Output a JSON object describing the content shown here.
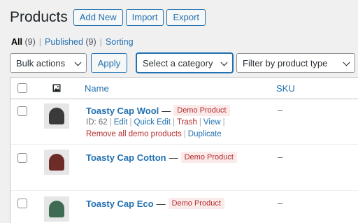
{
  "header": {
    "title": "Products",
    "buttons": {
      "add_new": "Add New",
      "import": "Import",
      "export": "Export"
    }
  },
  "subsubsub": {
    "all": {
      "label": "All",
      "count": "(9)"
    },
    "published": {
      "label": "Published",
      "count": "(9)"
    },
    "sorting": {
      "label": "Sorting"
    },
    "separator": "|"
  },
  "controls": {
    "bulk_actions": "Bulk actions",
    "apply": "Apply",
    "category": "Select a category",
    "product_type": "Filter by product type"
  },
  "table": {
    "columns": {
      "name": "Name",
      "sku": "SKU"
    },
    "rows": [
      {
        "name": "Toasty Cap Wool",
        "dash": "—",
        "badge": "Demo Product",
        "sku": "–",
        "cap_color": "#3a3a3a"
      },
      {
        "name": "Toasty Cap Cotton",
        "dash": "—",
        "badge": "Demo Product",
        "sku": "–",
        "cap_color": "#6e2c28"
      },
      {
        "name": "Toasty Cap Eco",
        "dash": "—",
        "badge": "Demo Product",
        "sku": "–",
        "cap_color": "#3f6b53"
      }
    ],
    "row_actions": {
      "id": "ID: 62",
      "edit": "Edit",
      "quick_edit": "Quick Edit",
      "trash": "Trash",
      "view": "View",
      "remove_demo": "Remove all demo products",
      "duplicate": "Duplicate",
      "pipe": "|"
    }
  },
  "colors": {
    "accent": "#2271b1",
    "danger": "#b32d2e",
    "badge_bg": "#fbeaea"
  }
}
